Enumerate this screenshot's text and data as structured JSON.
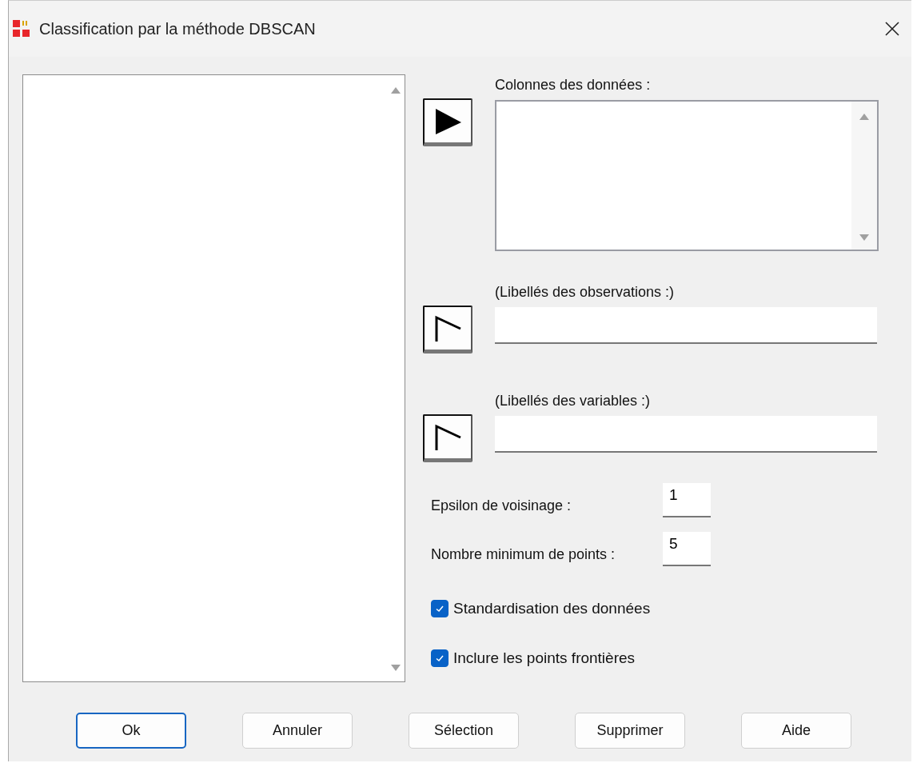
{
  "window": {
    "title": "Classification par la méthode DBSCAN"
  },
  "data_columns": {
    "label": "Colonnes des données :",
    "move_button": {
      "kind": "filled"
    }
  },
  "fields": [
    {
      "label": "(Libellés des observations :)",
      "move_button": {
        "kind": "outline"
      }
    },
    {
      "label": "(Libellés des variables :)",
      "move_button": {
        "kind": "outline"
      }
    }
  ],
  "parameters": [
    {
      "label": "Epsilon de voisinage :",
      "value": "1"
    },
    {
      "label": "Nombre minimum de points :",
      "value": "5"
    }
  ],
  "options": [
    {
      "label": "Standardisation des données",
      "checked": true
    },
    {
      "label": "Inclure les points frontières",
      "checked": true
    }
  ],
  "buttons": [
    {
      "label": "Ok",
      "default": true
    },
    {
      "label": "Annuler",
      "default": false
    },
    {
      "label": "Sélection",
      "default": false
    },
    {
      "label": "Supprimer",
      "default": false
    },
    {
      "label": "Aide",
      "default": false
    }
  ]
}
